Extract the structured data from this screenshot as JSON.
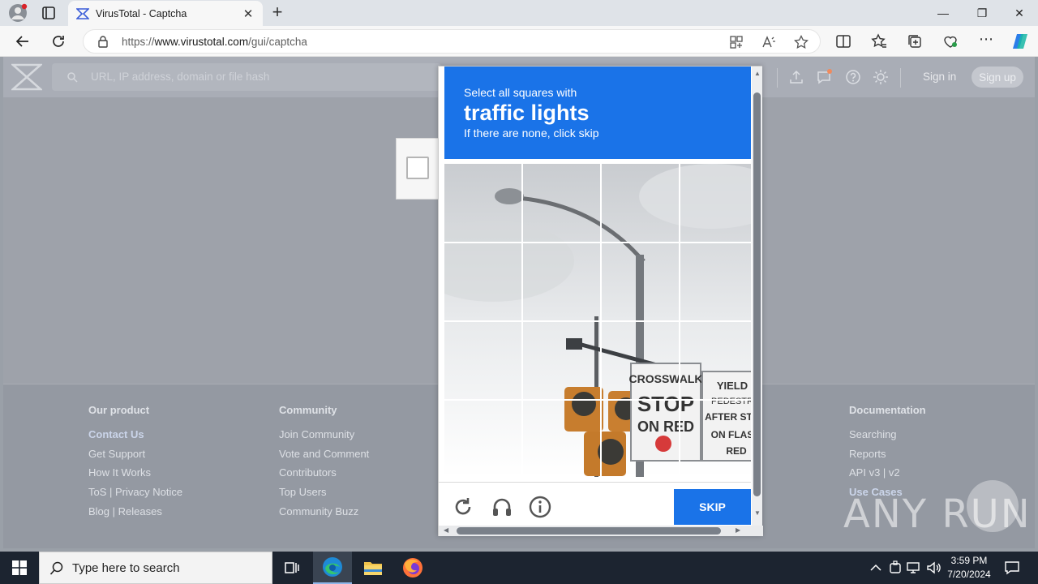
{
  "browser": {
    "tab_title": "VirusTotal - Captcha",
    "url_prefix": "https://",
    "url_domain": "www.virustotal.com",
    "url_path": "/gui/captcha",
    "close_tab_glyph": "✕",
    "new_tab_glyph": "+",
    "minimize_glyph": "—",
    "maximize_glyph": "❐",
    "close_glyph": "✕"
  },
  "vt": {
    "search_placeholder": "URL, IP address, domain or file hash",
    "sign_in": "Sign in",
    "sign_up": "Sign up"
  },
  "footer": {
    "columns": [
      {
        "title": "Our product",
        "links": [
          "Contact Us",
          "Get Support",
          "How It Works",
          "ToS | Privacy Notice",
          "Blog | Releases"
        ]
      },
      {
        "title": "Community",
        "links": [
          "Join Community",
          "Vote and Comment",
          "Contributors",
          "Top Users",
          "Community Buzz"
        ]
      },
      {
        "title": "Documentation",
        "links": [
          "Searching",
          "Reports",
          "API v3 | v2",
          "Use Cases"
        ]
      }
    ]
  },
  "captcha": {
    "instruction_line1": "Select all squares with",
    "target_object": "traffic lights",
    "instruction_line3": "If there are none, click skip",
    "skip_label": "SKIP",
    "image_sign1_line1": "CROSSWALK",
    "image_sign1_line2": "STOP",
    "image_sign1_line3": "ON RED",
    "image_sign2_line1": "YIELD",
    "image_sign2_line2": "PEDESTR",
    "image_sign2_line3": "AFTER STO",
    "image_sign2_line4": "ON FLAS",
    "image_sign2_line5": "RED"
  },
  "watermark": {
    "text": "ANY RUN"
  },
  "taskbar": {
    "search_placeholder": "Type here to search",
    "time": "3:59 PM",
    "date": "7/20/2024"
  },
  "colors": {
    "captcha_blue": "#1a73e8",
    "taskbar": "#1c2430",
    "overlay_page": "#9ea2aa"
  },
  "icons": [
    "profile-icon",
    "tab-actions-icon",
    "virustotal-favicon",
    "back-icon",
    "refresh-icon",
    "lock-icon",
    "apps-icon",
    "read-aloud-icon",
    "favorite-icon",
    "split-screen-icon",
    "favorites-icon",
    "collections-icon",
    "browser-essentials-icon",
    "more-icon",
    "copilot-icon",
    "upload-icon",
    "chat-icon",
    "help-icon",
    "theme-icon",
    "reload-challenge-icon",
    "audio-challenge-icon",
    "info-icon",
    "windows-start-icon",
    "search-icon",
    "task-view-icon",
    "edge-icon",
    "file-explorer-icon",
    "firefox-icon",
    "chevron-up-icon",
    "network-icon",
    "volume-icon",
    "notifications-icon"
  ]
}
